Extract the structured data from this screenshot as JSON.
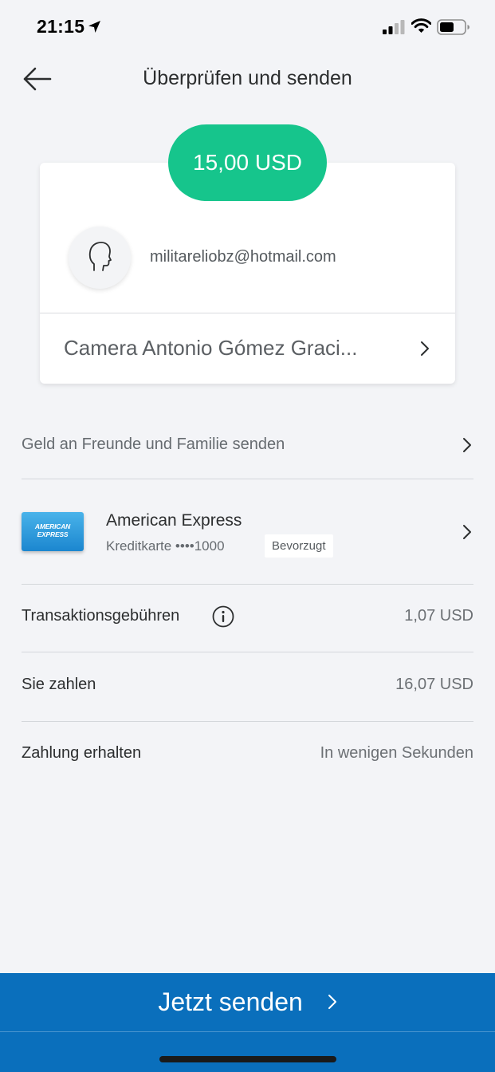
{
  "status_bar": {
    "time": "21:15",
    "icons": [
      "location-arrow-icon",
      "cellular-signal-icon",
      "wifi-icon",
      "battery-icon"
    ]
  },
  "header": {
    "title": "Überprüfen und senden",
    "back_icon": "arrow-left-icon"
  },
  "recipient": {
    "amount": "15,00 USD",
    "email": "militareliobz@hotmail.com",
    "name": "Camera Antonio Gómez Graci..."
  },
  "details": {
    "purpose": "Geld an Freunde und Familie senden",
    "card": {
      "logo_text": "AMERICAN EXPRESS",
      "name": "American Express",
      "detail": "Kreditkarte ••••1000",
      "badge": "Bevorzugt"
    },
    "fees": {
      "label": "Transaktionsgebühren",
      "value": "1,07 USD",
      "icon": "info-icon"
    },
    "total": {
      "label": "Sie zahlen",
      "value": "16,07 USD"
    },
    "delivery": {
      "label": "Zahlung erhalten",
      "value": "In wenigen Sekunden"
    }
  },
  "footer": {
    "send_label": "Jetzt senden"
  },
  "colors": {
    "accent_green": "#16c58c",
    "primary_blue": "#0a6fbc",
    "background": "#f3f4f7"
  }
}
